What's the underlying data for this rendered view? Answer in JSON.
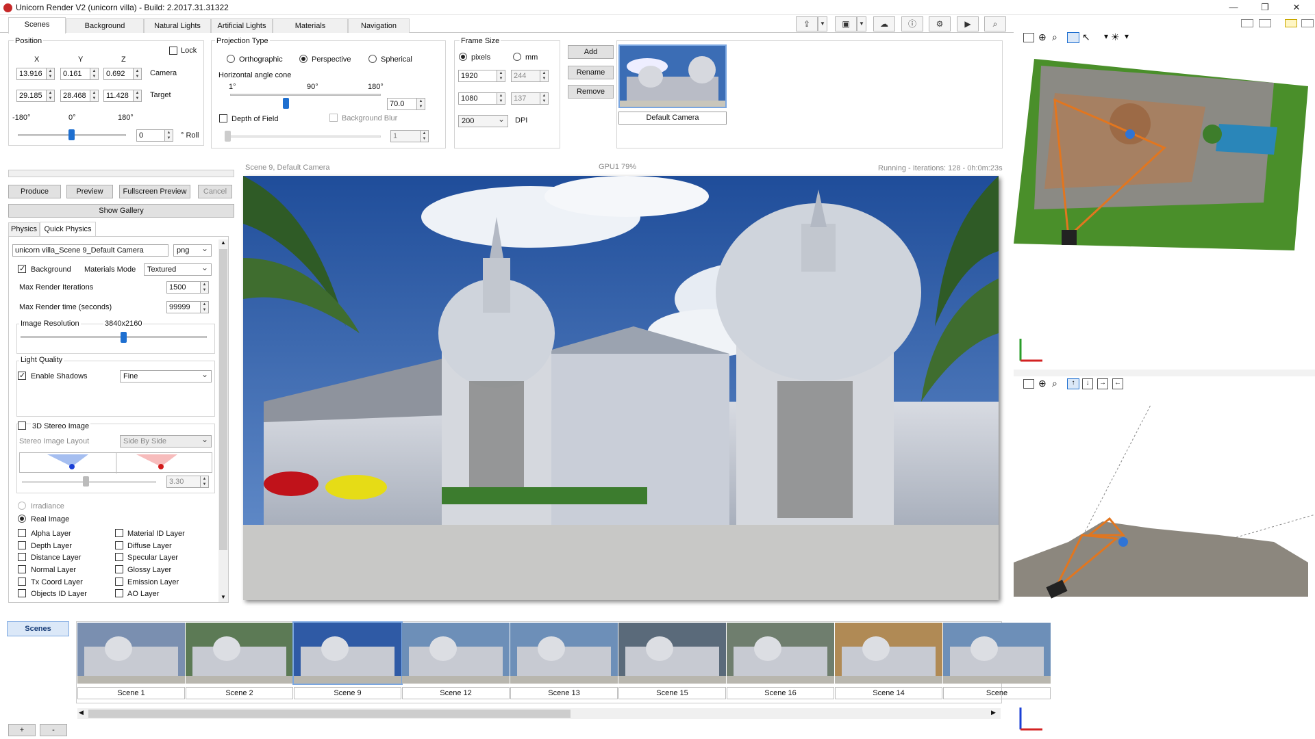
{
  "app": {
    "title": "Unicorn Render V2 (unicorn villa) - Build: 2.2017.31.31322"
  },
  "tabs": [
    "Scenes",
    "Background",
    "Natural Lights",
    "Artificial Lights",
    "Materials",
    "Navigation"
  ],
  "position": {
    "heading": "Position",
    "lock_label": "Lock",
    "axes": [
      "X",
      "Y",
      "Z"
    ],
    "camera_label": "Camera",
    "camera": [
      "13.916",
      "0.161",
      "0.692"
    ],
    "target_label": "Target",
    "target": [
      "29.185",
      "28.468",
      "11.428"
    ],
    "roll_ticks": [
      "-180°",
      "0°",
      "180°"
    ],
    "roll_value": "0",
    "roll_label": "° Roll"
  },
  "projection": {
    "heading": "Projection Type",
    "options": [
      "Orthographic",
      "Perspective",
      "Spherical"
    ],
    "selected": "Perspective",
    "angle_label": "Horizontal angle cone",
    "angle_ticks": [
      "1°",
      "90°",
      "180°"
    ],
    "angle_value": "70.0",
    "dof_label": "Depth of Field",
    "blur_label": "Background Blur",
    "blur_value": "1"
  },
  "frame": {
    "heading": "Frame Size",
    "unit_pixels": "pixels",
    "unit_mm": "mm",
    "width": "1920",
    "height": "1080",
    "width_mm": "244",
    "height_mm": "137",
    "dpi_value": "200",
    "dpi_label": "DPI"
  },
  "camera_buttons": [
    "Add",
    "Rename",
    "Remove"
  ],
  "camera_preview_label": "Default Camera",
  "render_actions": [
    "Produce",
    "Preview",
    "Fullscreen Preview",
    "Cancel"
  ],
  "show_gallery": "Show Gallery",
  "subtabs": [
    "Physics",
    "Quick Physics"
  ],
  "quick": {
    "filename": "unicorn villa_Scene 9_Default Camera",
    "format": "png",
    "background_label": "Background",
    "materials_mode_label": "Materials Mode",
    "materials_mode": "Textured",
    "max_iter_label": "Max Render Iterations",
    "max_iter": "1500",
    "max_time_label": "Max Render time (seconds)",
    "max_time": "99999",
    "resolution_label": "Image Resolution",
    "resolution": "3840x2160",
    "light_quality_label": "Light Quality",
    "shadows_label": "Enable Shadows",
    "shadows_value": "Fine",
    "stereo_label": "3D Stereo Image",
    "stereo_layout_label": "Stereo Image Layout",
    "stereo_layout": "Side By Side",
    "stereo_value": "3.30",
    "irradiance_label": "Irradiance",
    "real_image_label": "Real Image",
    "layers_left": [
      "Alpha Layer",
      "Depth Layer",
      "Distance Layer",
      "Normal Layer",
      "Tx Coord Layer",
      "Objects ID Layer"
    ],
    "layers_right": [
      "Material ID Layer",
      "Diffuse Layer",
      "Specular Layer",
      "Glossy Layer",
      "Emission Layer",
      "AO Layer"
    ]
  },
  "status": {
    "scene": "Scene 9, Default Camera",
    "gpu": "GPU1 79%",
    "running": "Running - Iterations: 128 - 0h:0m:23s"
  },
  "scenes_label": "Scenes",
  "scene_thumbs": [
    "Scene 1",
    "Scene 2",
    "Scene 9",
    "Scene 12",
    "Scene 13",
    "Scene 15",
    "Scene 16",
    "Scene 14",
    "Scene"
  ],
  "bottom_buttons": [
    "+",
    "-"
  ],
  "colors": {
    "accent": "#1e6fd0",
    "sky": "#2b5aa8"
  }
}
